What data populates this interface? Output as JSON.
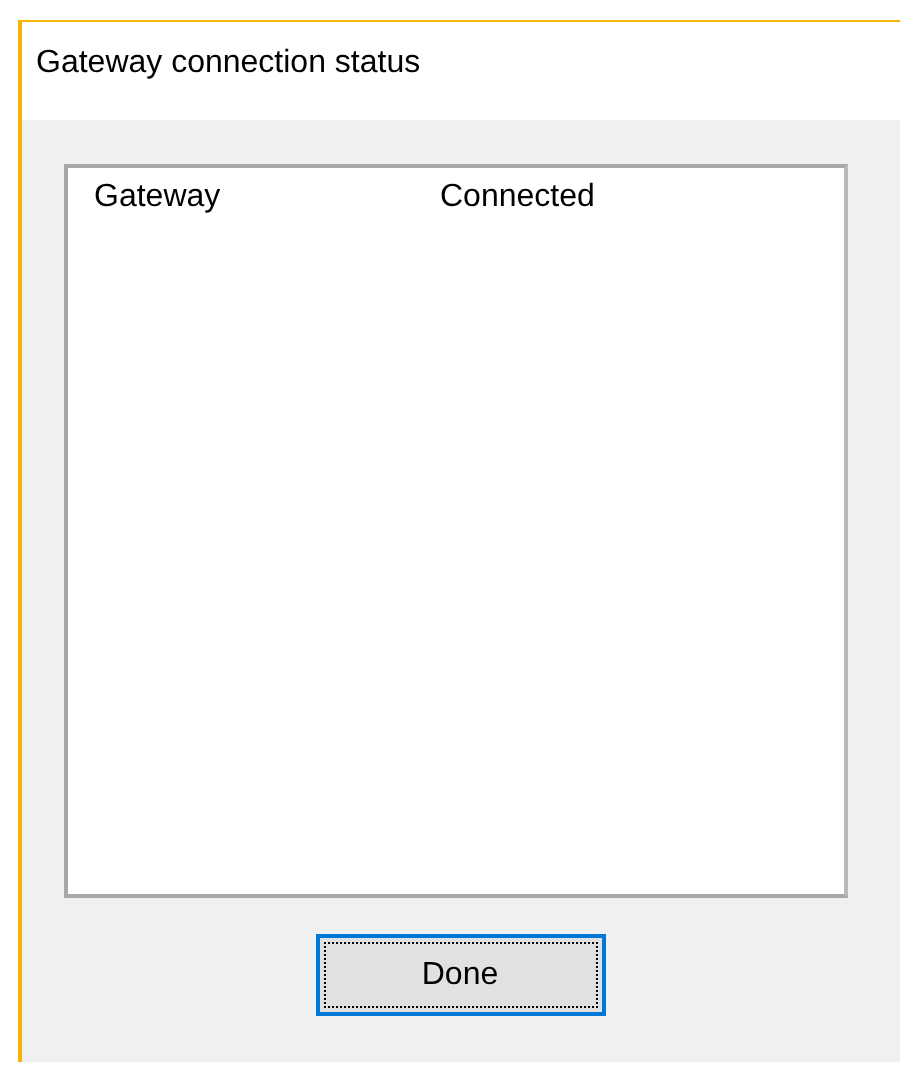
{
  "window": {
    "title": "Gateway connection status"
  },
  "list": {
    "rows": [
      {
        "name": "Gateway",
        "status": "Connected"
      }
    ]
  },
  "buttons": [
    {
      "label": "Done",
      "focused": true
    }
  ]
}
